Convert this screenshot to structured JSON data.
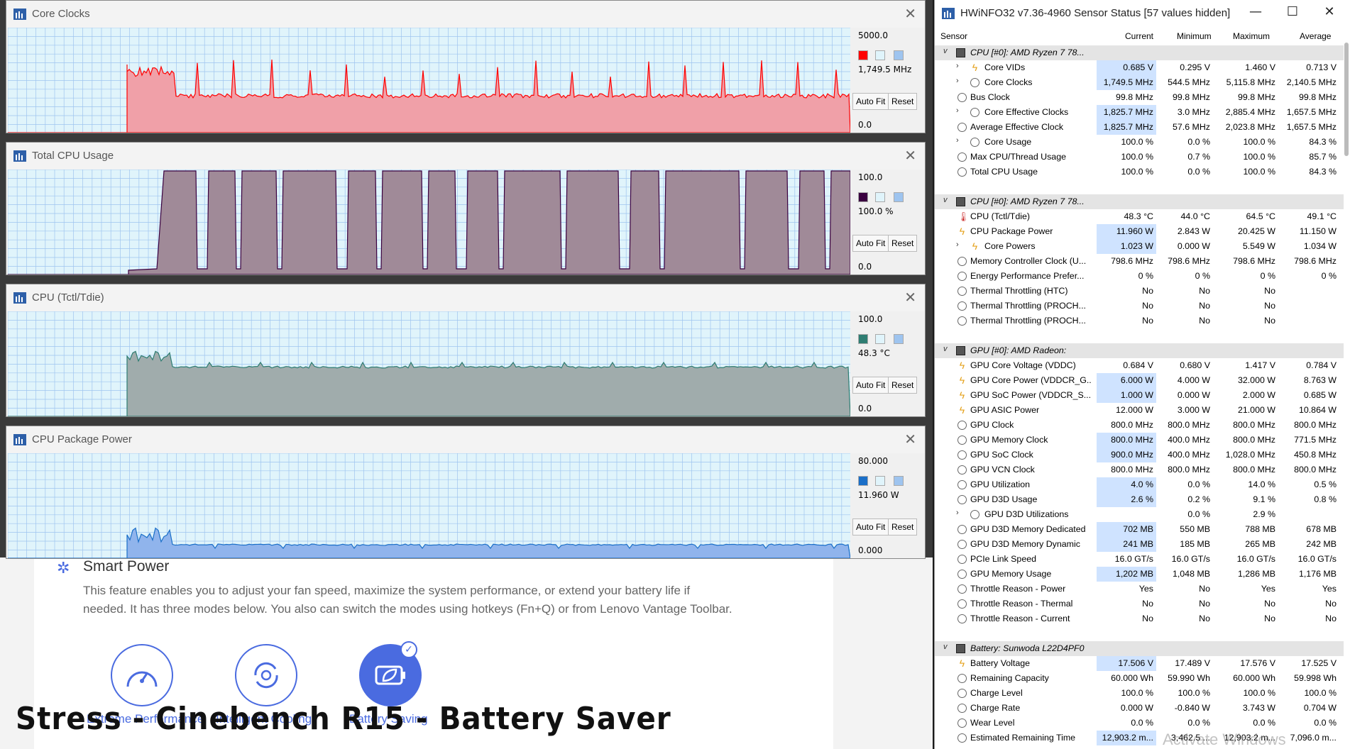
{
  "background": {
    "smart_power_title": "Smart Power",
    "smart_power_desc": "This feature enables you to adjust your fan speed, maximize the system performance, or extend your battery life if needed. It has three modes below. You also can switch the modes using hotkeys (Fn+Q) or from Lenovo Vantage Toolbar.",
    "modes": [
      {
        "label": "Extreme Performance",
        "icon": "speedometer-icon"
      },
      {
        "label": "Intelligent Cooling",
        "icon": "fan-cycle-icon"
      },
      {
        "label": "Battery Saving",
        "icon": "leaf-battery-icon"
      }
    ],
    "caption": "Stress - Cinebench R15 - Battery Saver"
  },
  "graphs": [
    {
      "title": "Core Clocks",
      "max": "5000.0",
      "value": "1,749.5 MHz",
      "min": "0.0",
      "color": "#ff0000",
      "fill": "#f0a0a8",
      "auto_fit": "Auto Fit",
      "reset": "Reset"
    },
    {
      "title": "Total CPU Usage",
      "max": "100.0",
      "value": "100.0 %",
      "min": "0.0",
      "color": "#3a0040",
      "fill": "#a08a98",
      "auto_fit": "Auto Fit",
      "reset": "Reset"
    },
    {
      "title": "CPU (Tctl/Tdie)",
      "max": "100.0",
      "value": "48.3 °C",
      "min": "0.0",
      "color": "#2e7d72",
      "fill": "#a0acac",
      "auto_fit": "Auto Fit",
      "reset": "Reset"
    },
    {
      "title": "CPU Package Power",
      "max": "80.000",
      "value": "11.960 W",
      "min": "0.000",
      "color": "#1a6fc8",
      "fill": "#90b4ec",
      "auto_fit": "Auto Fit",
      "reset": "Reset"
    }
  ],
  "hwinfo": {
    "title": "HWiNFO32 v7.36-4960 Sensor Status [57 values hidden]",
    "headers": {
      "sensor": "Sensor",
      "current": "Current",
      "minimum": "Minimum",
      "maximum": "Maximum",
      "average": "Average"
    },
    "rows": [
      {
        "t": "group",
        "name": "CPU [#0]: AMD Ryzen 7 78..."
      },
      {
        "t": "row",
        "exp": ">",
        "ic": "bolt",
        "indent": 1,
        "name": "Core VIDs",
        "cur": "0.685 V",
        "min": "0.295 V",
        "max": "1.460 V",
        "avg": "0.713 V",
        "hl": true
      },
      {
        "t": "row",
        "exp": ">",
        "ic": "circ",
        "indent": 1,
        "name": "Core Clocks",
        "cur": "1,749.5 MHz",
        "min": "544.5 MHz",
        "max": "5,115.8 MHz",
        "avg": "2,140.5 MHz",
        "hl": true
      },
      {
        "t": "row",
        "ic": "circ",
        "indent": 0,
        "name": "Bus Clock",
        "cur": "99.8 MHz",
        "min": "99.8 MHz",
        "max": "99.8 MHz",
        "avg": "99.8 MHz"
      },
      {
        "t": "row",
        "exp": ">",
        "ic": "circ",
        "indent": 1,
        "name": "Core Effective Clocks",
        "cur": "1,825.7 MHz",
        "min": "3.0 MHz",
        "max": "2,885.4 MHz",
        "avg": "1,657.5 MHz",
        "hl": true
      },
      {
        "t": "row",
        "ic": "circ",
        "indent": 0,
        "name": "Average Effective Clock",
        "cur": "1,825.7 MHz",
        "min": "57.6 MHz",
        "max": "2,023.8 MHz",
        "avg": "1,657.5 MHz",
        "hl": true
      },
      {
        "t": "row",
        "exp": ">",
        "ic": "circ",
        "indent": 1,
        "name": "Core Usage",
        "cur": "100.0 %",
        "min": "0.0 %",
        "max": "100.0 %",
        "avg": "84.3 %"
      },
      {
        "t": "row",
        "ic": "circ",
        "indent": 0,
        "name": "Max CPU/Thread Usage",
        "cur": "100.0 %",
        "min": "0.7 %",
        "max": "100.0 %",
        "avg": "85.7 %"
      },
      {
        "t": "row",
        "ic": "circ",
        "indent": 0,
        "name": "Total CPU Usage",
        "cur": "100.0 %",
        "min": "0.0 %",
        "max": "100.0 %",
        "avg": "84.3 %"
      },
      {
        "t": "spacer"
      },
      {
        "t": "group",
        "name": "CPU [#0]: AMD Ryzen 7 78..."
      },
      {
        "t": "row",
        "ic": "therm",
        "indent": 0,
        "name": "CPU (Tctl/Tdie)",
        "cur": "48.3 °C",
        "min": "44.0 °C",
        "max": "64.5 °C",
        "avg": "49.1 °C"
      },
      {
        "t": "row",
        "ic": "bolt",
        "indent": 0,
        "name": "CPU Package Power",
        "cur": "11.960 W",
        "min": "2.843 W",
        "max": "20.425 W",
        "avg": "11.150 W",
        "hl": true
      },
      {
        "t": "row",
        "exp": ">",
        "ic": "bolt",
        "indent": 1,
        "name": "Core Powers",
        "cur": "1.023 W",
        "min": "0.000 W",
        "max": "5.549 W",
        "avg": "1.034 W",
        "hl": true
      },
      {
        "t": "row",
        "ic": "circ",
        "indent": 0,
        "name": "Memory Controller Clock (U...",
        "cur": "798.6 MHz",
        "min": "798.6 MHz",
        "max": "798.6 MHz",
        "avg": "798.6 MHz"
      },
      {
        "t": "row",
        "ic": "circ",
        "indent": 0,
        "name": "Energy Performance Prefer...",
        "cur": "0 %",
        "min": "0 %",
        "max": "0 %",
        "avg": "0 %"
      },
      {
        "t": "row",
        "ic": "circ",
        "indent": 0,
        "name": "Thermal Throttling (HTC)",
        "cur": "No",
        "min": "No",
        "max": "No",
        "avg": ""
      },
      {
        "t": "row",
        "ic": "circ",
        "indent": 0,
        "name": "Thermal Throttling (PROCH...",
        "cur": "No",
        "min": "No",
        "max": "No",
        "avg": ""
      },
      {
        "t": "row",
        "ic": "circ",
        "indent": 0,
        "name": "Thermal Throttling (PROCH...",
        "cur": "No",
        "min": "No",
        "max": "No",
        "avg": ""
      },
      {
        "t": "spacer"
      },
      {
        "t": "group",
        "name": "GPU [#0]: AMD Radeon:"
      },
      {
        "t": "row",
        "ic": "bolt",
        "indent": 0,
        "name": "GPU Core Voltage (VDDC)",
        "cur": "0.684 V",
        "min": "0.680 V",
        "max": "1.417 V",
        "avg": "0.784 V"
      },
      {
        "t": "row",
        "ic": "bolt",
        "indent": 0,
        "name": "GPU Core Power (VDDCR_G...",
        "cur": "6.000 W",
        "min": "4.000 W",
        "max": "32.000 W",
        "avg": "8.763 W",
        "hl": true
      },
      {
        "t": "row",
        "ic": "bolt",
        "indent": 0,
        "name": "GPU SoC Power (VDDCR_S...",
        "cur": "1.000 W",
        "min": "0.000 W",
        "max": "2.000 W",
        "avg": "0.685 W",
        "hl": true
      },
      {
        "t": "row",
        "ic": "bolt",
        "indent": 0,
        "name": "GPU ASIC Power",
        "cur": "12.000 W",
        "min": "3.000 W",
        "max": "21.000 W",
        "avg": "10.864 W"
      },
      {
        "t": "row",
        "ic": "circ",
        "indent": 0,
        "name": "GPU Clock",
        "cur": "800.0 MHz",
        "min": "800.0 MHz",
        "max": "800.0 MHz",
        "avg": "800.0 MHz"
      },
      {
        "t": "row",
        "ic": "circ",
        "indent": 0,
        "name": "GPU Memory Clock",
        "cur": "800.0 MHz",
        "min": "400.0 MHz",
        "max": "800.0 MHz",
        "avg": "771.5 MHz",
        "hl": true
      },
      {
        "t": "row",
        "ic": "circ",
        "indent": 0,
        "name": "GPU SoC Clock",
        "cur": "900.0 MHz",
        "min": "400.0 MHz",
        "max": "1,028.0 MHz",
        "avg": "450.8 MHz",
        "hl": true
      },
      {
        "t": "row",
        "ic": "circ",
        "indent": 0,
        "name": "GPU VCN Clock",
        "cur": "800.0 MHz",
        "min": "800.0 MHz",
        "max": "800.0 MHz",
        "avg": "800.0 MHz"
      },
      {
        "t": "row",
        "ic": "circ",
        "indent": 0,
        "name": "GPU Utilization",
        "cur": "4.0 %",
        "min": "0.0 %",
        "max": "14.0 %",
        "avg": "0.5 %",
        "hl": true
      },
      {
        "t": "row",
        "ic": "circ",
        "indent": 0,
        "name": "GPU D3D Usage",
        "cur": "2.6 %",
        "min": "0.2 %",
        "max": "9.1 %",
        "avg": "0.8 %",
        "hl": true
      },
      {
        "t": "row",
        "exp": ">",
        "ic": "circ",
        "indent": 1,
        "name": "GPU D3D Utilizations",
        "cur": "",
        "min": "0.0 %",
        "max": "2.9 %",
        "avg": ""
      },
      {
        "t": "row",
        "ic": "circ",
        "indent": 0,
        "name": "GPU D3D Memory Dedicated",
        "cur": "702 MB",
        "min": "550 MB",
        "max": "788 MB",
        "avg": "678 MB",
        "hl": true
      },
      {
        "t": "row",
        "ic": "circ",
        "indent": 0,
        "name": "GPU D3D Memory Dynamic",
        "cur": "241 MB",
        "min": "185 MB",
        "max": "265 MB",
        "avg": "242 MB",
        "hl": true
      },
      {
        "t": "row",
        "ic": "circ",
        "indent": 0,
        "name": "PCIe Link Speed",
        "cur": "16.0 GT/s",
        "min": "16.0 GT/s",
        "max": "16.0 GT/s",
        "avg": "16.0 GT/s"
      },
      {
        "t": "row",
        "ic": "circ",
        "indent": 0,
        "name": "GPU Memory Usage",
        "cur": "1,202 MB",
        "min": "1,048 MB",
        "max": "1,286 MB",
        "avg": "1,176 MB",
        "hl": true
      },
      {
        "t": "row",
        "ic": "circ",
        "indent": 0,
        "name": "Throttle Reason - Power",
        "cur": "Yes",
        "min": "No",
        "max": "Yes",
        "avg": "Yes"
      },
      {
        "t": "row",
        "ic": "circ",
        "indent": 0,
        "name": "Throttle Reason - Thermal",
        "cur": "No",
        "min": "No",
        "max": "No",
        "avg": "No"
      },
      {
        "t": "row",
        "ic": "circ",
        "indent": 0,
        "name": "Throttle Reason - Current",
        "cur": "No",
        "min": "No",
        "max": "No",
        "avg": "No"
      },
      {
        "t": "spacer"
      },
      {
        "t": "group",
        "name": "Battery: Sunwoda L22D4PF0"
      },
      {
        "t": "row",
        "ic": "bolt",
        "indent": 0,
        "name": "Battery Voltage",
        "cur": "17.506 V",
        "min": "17.489 V",
        "max": "17.576 V",
        "avg": "17.525 V",
        "hl": true
      },
      {
        "t": "row",
        "ic": "circ",
        "indent": 0,
        "name": "Remaining Capacity",
        "cur": "60.000 Wh",
        "min": "59.990 Wh",
        "max": "60.000 Wh",
        "avg": "59.998 Wh"
      },
      {
        "t": "row",
        "ic": "circ",
        "indent": 0,
        "name": "Charge Level",
        "cur": "100.0 %",
        "min": "100.0 %",
        "max": "100.0 %",
        "avg": "100.0 %"
      },
      {
        "t": "row",
        "ic": "circ",
        "indent": 0,
        "name": "Charge Rate",
        "cur": "0.000 W",
        "min": "-0.840 W",
        "max": "3.743 W",
        "avg": "0.704 W"
      },
      {
        "t": "row",
        "ic": "circ",
        "indent": 0,
        "name": "Wear Level",
        "cur": "0.0 %",
        "min": "0.0 %",
        "max": "0.0 %",
        "avg": "0.0 %"
      },
      {
        "t": "row",
        "ic": "circ",
        "indent": 0,
        "name": "Estimated Remaining Time",
        "cur": "12,903.2 m...",
        "min": "3,462.5 ...",
        "max": "12,903.2 m...",
        "avg": "7,096.0 m...",
        "hl": true
      }
    ],
    "watermark": "Activate Windows"
  }
}
